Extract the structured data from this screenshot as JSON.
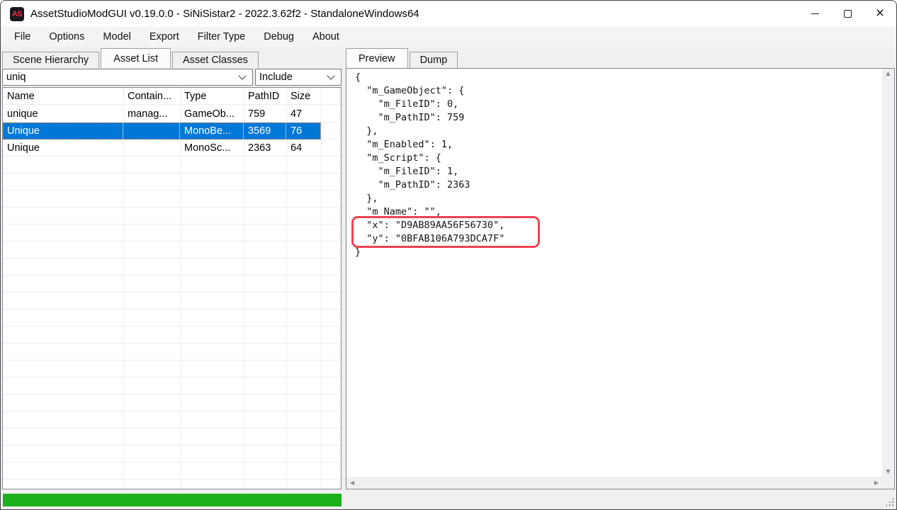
{
  "window": {
    "title": "AssetStudioModGUI v0.19.0.0 - SiNiSistar2 - 2022.3.62f2 - StandaloneWindows64",
    "icon_text": "AS"
  },
  "menu": {
    "items": [
      "File",
      "Options",
      "Model",
      "Export",
      "Filter Type",
      "Debug",
      "About"
    ]
  },
  "left_panel": {
    "tabs": [
      "Scene Hierarchy",
      "Asset List",
      "Asset Classes"
    ],
    "active_tab": "Asset List",
    "search": {
      "value": "uniq"
    },
    "filter_mode": {
      "value": "Include"
    },
    "table": {
      "columns": [
        "Name",
        "Contain...",
        "Type",
        "PathID",
        "Size"
      ],
      "rows": [
        {
          "name": "unique",
          "container": "manag...",
          "type": "GameOb...",
          "path_id": "759",
          "size": "47",
          "selected": false
        },
        {
          "name": "Unique",
          "container": "",
          "type": "MonoBe...",
          "path_id": "3569",
          "size": "76",
          "selected": true
        },
        {
          "name": "Unique",
          "container": "",
          "type": "MonoSc...",
          "path_id": "2363",
          "size": "64",
          "selected": false
        }
      ]
    },
    "progress": {
      "percent": 100,
      "color": "#1cb11c"
    }
  },
  "right_panel": {
    "tabs": [
      "Preview",
      "Dump"
    ],
    "active_tab": "Preview",
    "preview_text": "{\n  \"m_GameObject\": {\n    \"m_FileID\": 0,\n    \"m_PathID\": 759\n  },\n  \"m_Enabled\": 1,\n  \"m_Script\": {\n    \"m_FileID\": 1,\n    \"m_PathID\": 2363\n  },\n  \"m_Name\": \"\",\n  \"x\": \"D9AB89AA56F56730\",\n  \"y\": \"0BFAB106A793DCA7F\"\n}",
    "annotation_color": "#ee4454"
  },
  "colors": {
    "selection_blue": "#0078d7",
    "progress_green": "#1cb11c",
    "annotation_red": "#ee4454"
  }
}
